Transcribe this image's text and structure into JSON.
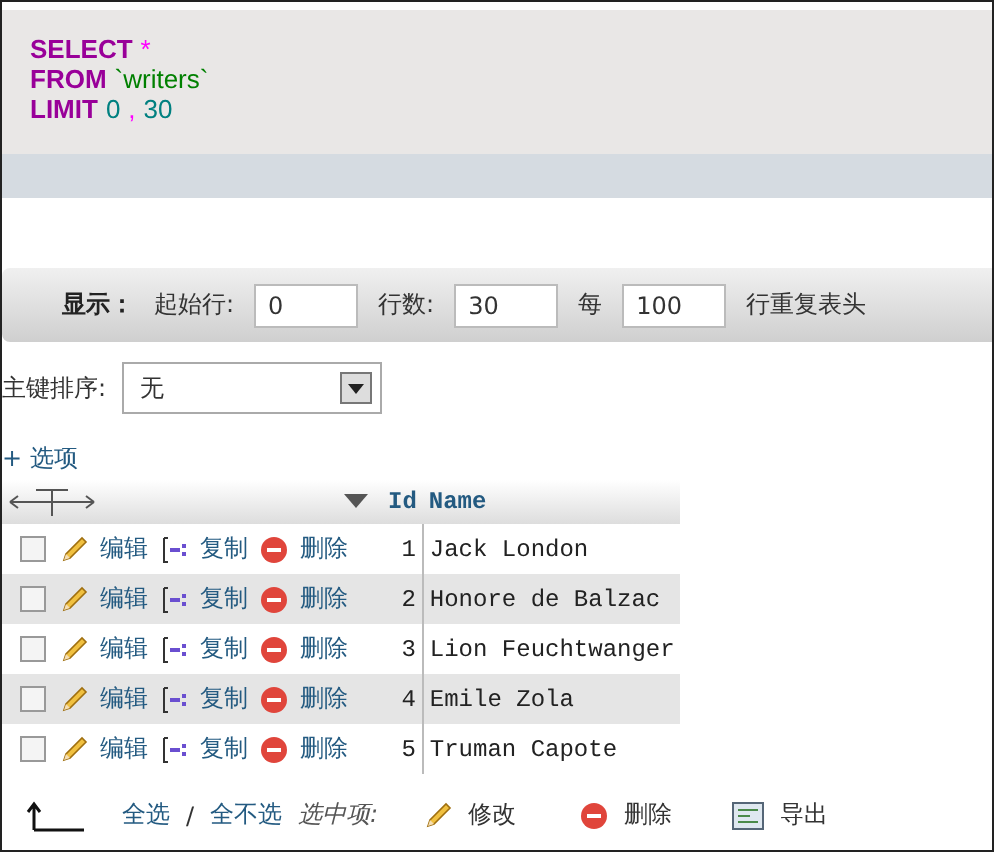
{
  "sql": {
    "lines": [
      [
        {
          "kind": "keyword",
          "text": "SELECT"
        },
        {
          "kind": "operator",
          "text": "*"
        }
      ],
      [
        {
          "kind": "keyword",
          "text": "FROM"
        },
        {
          "kind": "identifier",
          "text": "`writers`"
        }
      ],
      [
        {
          "kind": "keyword",
          "text": "LIMIT"
        },
        {
          "kind": "number",
          "text": "0"
        },
        {
          "kind": "operator",
          "text": ","
        },
        {
          "kind": "number",
          "text": "30"
        }
      ]
    ]
  },
  "display_bar": {
    "label": "显示：",
    "start_label": "起始行:",
    "start_value": "0",
    "rows_label": "行数:",
    "rows_value": "30",
    "every_label": "每",
    "every_value": "100",
    "repeat_label": "行重复表头"
  },
  "sort": {
    "label": "主键排序:",
    "value": "无"
  },
  "options_link": "+ 选项",
  "table": {
    "columns": [
      "Id",
      "Name"
    ],
    "rows": [
      {
        "checked": false,
        "edit": "编辑",
        "copy": "复制",
        "delete": "删除",
        "id": "1",
        "name": "Jack London"
      },
      {
        "checked": false,
        "edit": "编辑",
        "copy": "复制",
        "delete": "删除",
        "id": "2",
        "name": "Honore de Balzac"
      },
      {
        "checked": false,
        "edit": "编辑",
        "copy": "复制",
        "delete": "删除",
        "id": "3",
        "name": "Lion Feuchtwanger"
      },
      {
        "checked": false,
        "edit": "编辑",
        "copy": "复制",
        "delete": "删除",
        "id": "4",
        "name": "Emile Zola"
      },
      {
        "checked": false,
        "edit": "编辑",
        "copy": "复制",
        "delete": "删除",
        "id": "5",
        "name": "Truman Capote"
      }
    ]
  },
  "footer": {
    "select_all": "全选",
    "separator": "/",
    "select_none": "全不选",
    "with_selected": "选中项:",
    "edit": "修改",
    "delete": "删除",
    "export": "导出"
  }
}
